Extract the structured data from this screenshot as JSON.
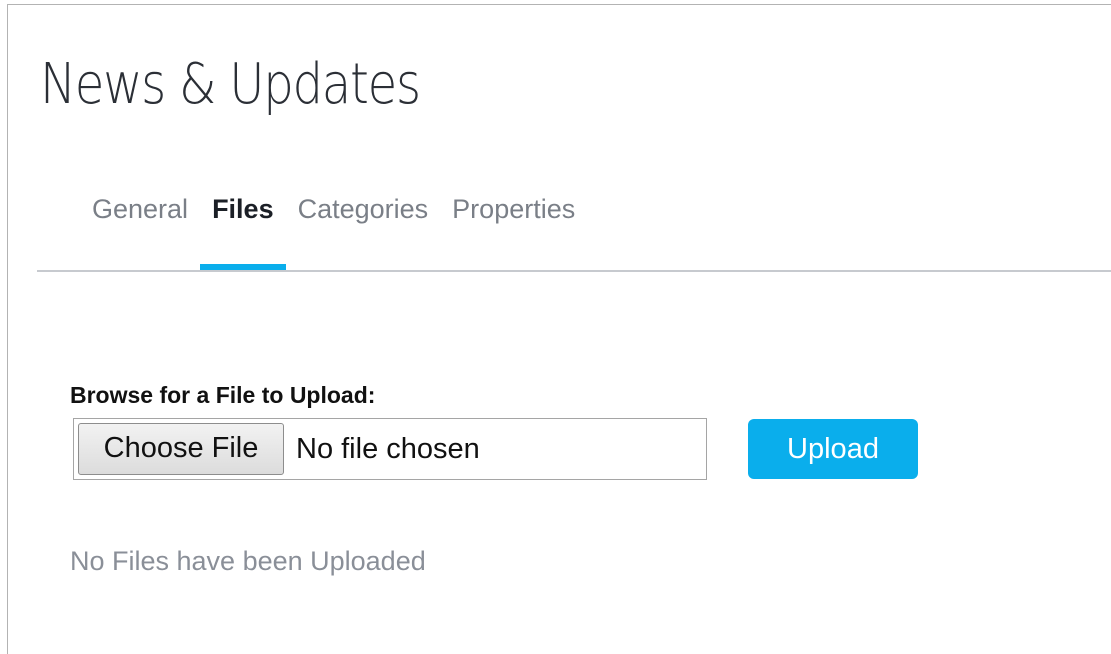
{
  "page": {
    "title": "News & Updates"
  },
  "tabs": [
    {
      "label": "General",
      "active": false
    },
    {
      "label": "Files",
      "active": true
    },
    {
      "label": "Categories",
      "active": false
    },
    {
      "label": "Properties",
      "active": false
    }
  ],
  "upload": {
    "label": "Browse for a File to Upload:",
    "choose_file_label": "Choose File",
    "file_status": "No file chosen",
    "upload_button_label": "Upload"
  },
  "files": {
    "empty_message": "No Files have been Uploaded"
  },
  "colors": {
    "accent": "#0aaeec",
    "title": "#2b2f36",
    "tab_inactive": "#7a7f87",
    "muted_text": "#8a8f98"
  }
}
